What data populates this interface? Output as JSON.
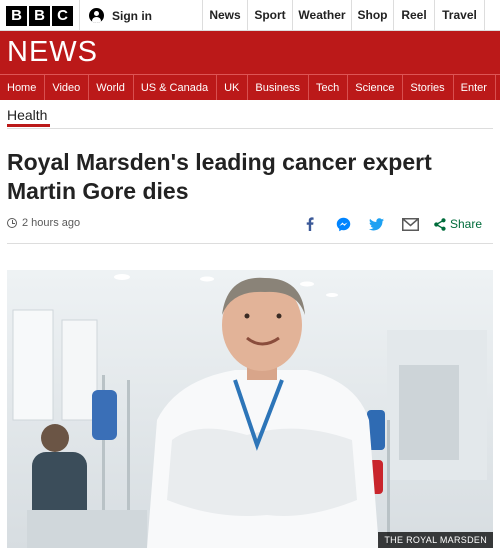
{
  "top_bar": {
    "logo_letters": [
      "B",
      "B",
      "C"
    ],
    "signin_label": "Sign in",
    "nav": [
      "News",
      "Sport",
      "Weather",
      "Shop",
      "Reel",
      "Travel"
    ]
  },
  "banner": {
    "title": "NEWS"
  },
  "section_nav": [
    "Home",
    "Video",
    "World",
    "US & Canada",
    "UK",
    "Business",
    "Tech",
    "Science",
    "Stories",
    "Enter"
  ],
  "section_label": "Health",
  "headline": "Royal Marsden's leading cancer expert Martin Gore dies",
  "meta": {
    "timestamp": "2 hours ago"
  },
  "share": {
    "label": "Share",
    "icons": [
      "facebook-icon",
      "messenger-icon",
      "twitter-icon",
      "email-icon",
      "share-icon"
    ]
  },
  "photo": {
    "caption": "THE ROYAL MARSDEN"
  },
  "colors": {
    "brand_red": "#bb1919",
    "share_green": "#006c3b",
    "text": "#222222"
  }
}
